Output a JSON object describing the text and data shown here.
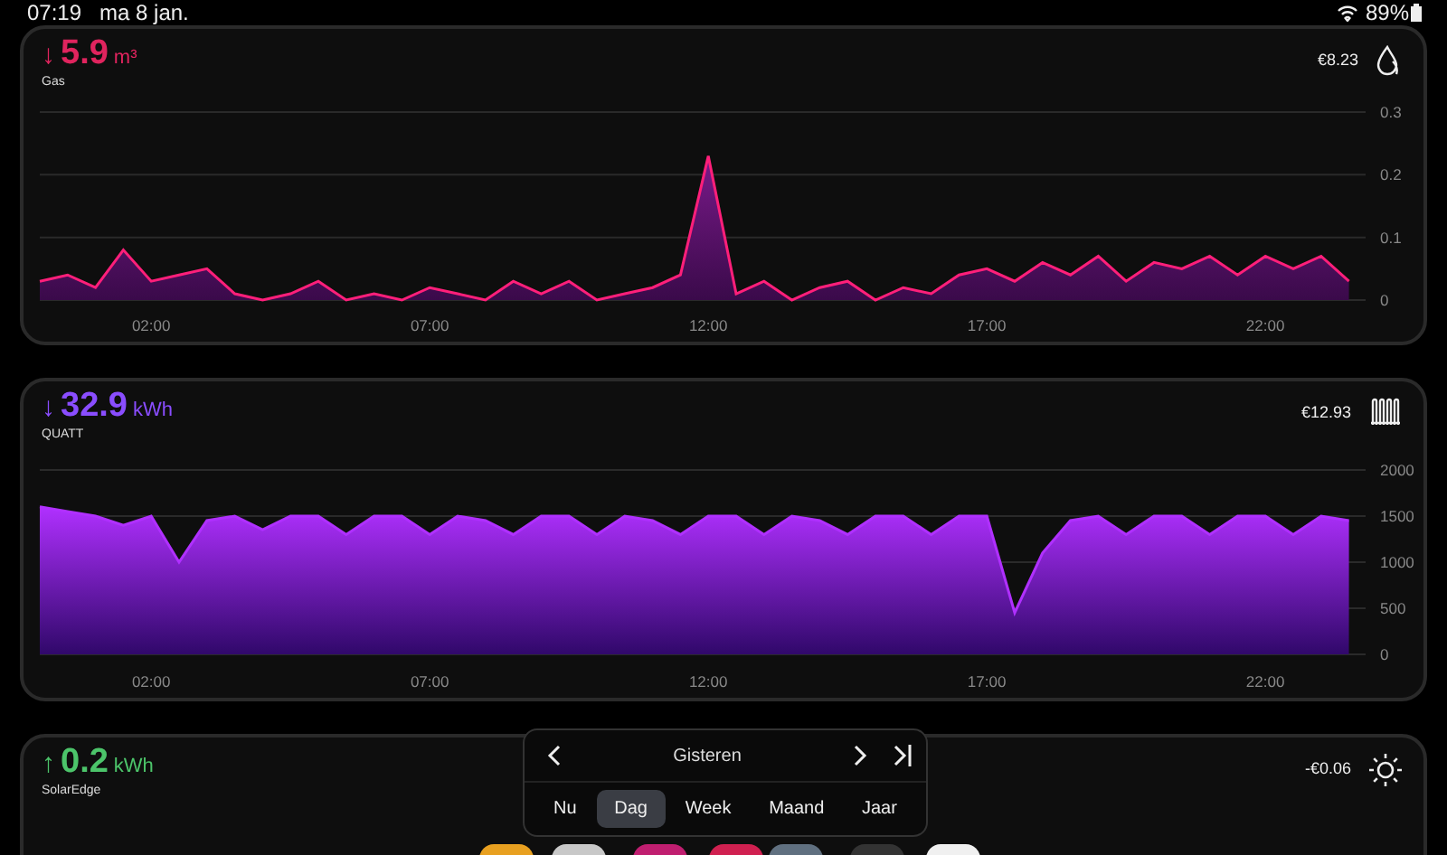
{
  "status_bar": {
    "time": "07:19",
    "date": "ma 8 jan.",
    "battery": "89%"
  },
  "cards": [
    {
      "kind": "gas",
      "arrow": "↓",
      "value": "5.9",
      "unit": "m³",
      "label": "Gas",
      "cost": "€8.23",
      "color": "#e0245e",
      "chart_data": {
        "type": "area",
        "x": [
          0,
          0.5,
          1,
          1.5,
          2,
          2.5,
          3,
          3.5,
          4,
          4.5,
          5,
          5.5,
          6,
          6.5,
          7,
          7.5,
          8,
          8.5,
          9,
          9.5,
          10,
          10.5,
          11,
          11.5,
          12,
          12.5,
          13,
          13.5,
          14,
          14.5,
          15,
          15.5,
          16,
          16.5,
          17,
          17.5,
          18,
          18.5,
          19,
          19.5,
          20,
          20.5,
          21,
          21.5,
          22,
          22.5,
          23,
          23.5
        ],
        "xticks": [
          {
            "value": 2,
            "label": "02:00"
          },
          {
            "value": 7,
            "label": "07:00"
          },
          {
            "value": 12,
            "label": "12:00"
          },
          {
            "value": 17,
            "label": "17:00"
          },
          {
            "value": 22,
            "label": "22:00"
          }
        ],
        "xlim": [
          0,
          23.8
        ],
        "grid": true,
        "ylim": [
          0,
          0.3
        ],
        "yticks": [
          0,
          0.1,
          0.2,
          0.3
        ],
        "series": [
          {
            "color": "#ff1f7a",
            "values": [
              0.03,
              0.04,
              0.02,
              0.08,
              0.03,
              0.04,
              0.05,
              0.01,
              0,
              0.01,
              0.03,
              0,
              0.01,
              0,
              0.02,
              0.01,
              0,
              0.03,
              0.01,
              0.03,
              0,
              0.01,
              0.02,
              0.04,
              0.23,
              0.01,
              0.03,
              0,
              0.02,
              0.03,
              0,
              0.02,
              0.01,
              0.04,
              0.05,
              0.03,
              0.06,
              0.04,
              0.07,
              0.03,
              0.06,
              0.05,
              0.07,
              0.04,
              0.07,
              0.05,
              0.07,
              0.03
            ]
          }
        ]
      }
    },
    {
      "kind": "heatpump",
      "arrow": "↓",
      "value": "32.9",
      "unit": "kWh",
      "label": "QUATT",
      "cost": "€12.93",
      "color": "#8a4dff",
      "chart_data": {
        "type": "area",
        "x": [
          0,
          0.5,
          1,
          1.5,
          2,
          2.5,
          3,
          3.5,
          4,
          4.5,
          5,
          5.5,
          6,
          6.5,
          7,
          7.5,
          8,
          8.5,
          9,
          9.5,
          10,
          10.5,
          11,
          11.5,
          12,
          12.5,
          13,
          13.5,
          14,
          14.5,
          15,
          15.5,
          16,
          16.5,
          17,
          17.5,
          18,
          18.5,
          19,
          19.5,
          20,
          20.5,
          21,
          21.5,
          22,
          22.5,
          23,
          23.5
        ],
        "xticks": [
          {
            "value": 2,
            "label": "02:00"
          },
          {
            "value": 7,
            "label": "07:00"
          },
          {
            "value": 12,
            "label": "12:00"
          },
          {
            "value": 17,
            "label": "17:00"
          },
          {
            "value": 22,
            "label": "22:00"
          }
        ],
        "xlim": [
          0,
          23.8
        ],
        "grid": true,
        "ylim": [
          0,
          2000
        ],
        "yticks": [
          0,
          500,
          1000,
          1500,
          2000
        ],
        "series": [
          {
            "color": "#b030ff",
            "values": [
              1600,
              1550,
              1500,
              1400,
              1500,
              1000,
              1450,
              1500,
              1350,
              1500,
              1500,
              1300,
              1500,
              1500,
              1300,
              1500,
              1450,
              1300,
              1500,
              1500,
              1300,
              1500,
              1450,
              1300,
              1500,
              1500,
              1300,
              1500,
              1450,
              1300,
              1500,
              1500,
              1300,
              1500,
              1500,
              450,
              1100,
              1450,
              1500,
              1300,
              1500,
              1500,
              1300,
              1500,
              1500,
              1300,
              1500,
              1450
            ]
          }
        ]
      }
    },
    {
      "kind": "solar",
      "arrow": "↑",
      "value": "0.2",
      "unit": "kWh",
      "label": "SolarEdge",
      "cost": "-€0.06",
      "color": "#4cc46a"
    }
  ],
  "period_picker": {
    "title": "Gisteren",
    "tabs": [
      {
        "label": "Nu",
        "selected": false
      },
      {
        "label": "Dag",
        "selected": true
      },
      {
        "label": "Week",
        "selected": false
      },
      {
        "label": "Maand",
        "selected": false
      },
      {
        "label": "Jaar",
        "selected": false
      }
    ]
  }
}
